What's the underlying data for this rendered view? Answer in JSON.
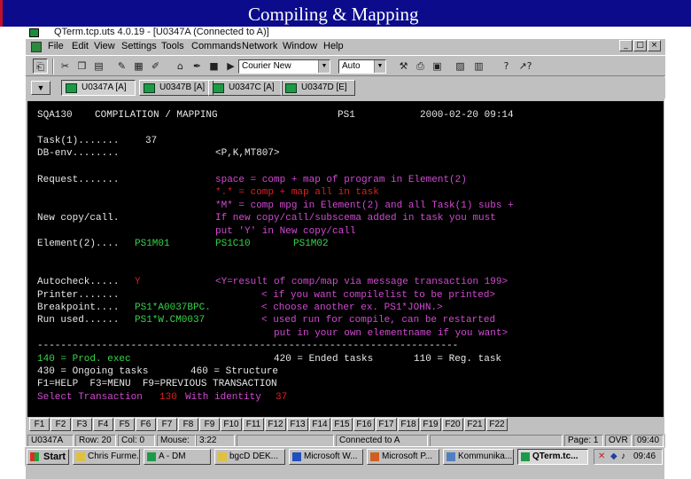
{
  "slide": {
    "title": "Compiling & Mapping"
  },
  "window": {
    "title": "QTerm.tcp.uts 4.0.19 - [U0347A (Connected to A)]",
    "controls": {
      "min": "_",
      "max": "□",
      "close": "×"
    }
  },
  "menu": [
    "File",
    "Edit",
    "View",
    "Settings",
    "Tools",
    "Commands",
    "Network",
    "Window",
    "Help"
  ],
  "toolbar": {
    "font_combo": "Courier New",
    "size_combo": "Auto",
    "help_glyph": "?",
    "whatsthis_glyph": "↗?"
  },
  "sessions": {
    "dropdown": "▼",
    "tabs": [
      {
        "label": "U0347A [A]",
        "active": true
      },
      {
        "label": "U0347B [A]",
        "active": false
      },
      {
        "label": "U0347C [A]",
        "active": false
      },
      {
        "label": "U0347D [E]",
        "active": false
      }
    ]
  },
  "terminal": {
    "header": {
      "screen_id": "SQA130",
      "title": "COMPILATION / MAPPING",
      "system": "PS1",
      "datetime": "2000-02-20 09:14"
    },
    "task_label": "Task(1).......",
    "task_value": "37",
    "dbenv_label": "DB-env........",
    "dbenv_value": "<P,K,MT807>",
    "request_label": "Request.......",
    "request_help": [
      "space = comp + map of program in Element(2)",
      "*.* = comp + map all in task",
      "*M* = comp mpg in Element(2) and all Task(1) subs +",
      "If new copy/call/subscema added in task you must",
      "put 'Y' in New copy/call"
    ],
    "newcopy_label": "New copy/call.",
    "element_label": "Element(2)....",
    "element_values": [
      "PS1M01",
      "PS1C10",
      "PS1M02"
    ],
    "autocheck_label": "Autocheck.....",
    "autocheck_value": "Y",
    "autocheck_help": "<Y=result of comp/map via message transaction 199>",
    "printer_label": "Printer.......",
    "printer_help": "< if you want compilelist to be printed>",
    "breakpoint_label": "Breakpoint....",
    "breakpoint_value": "PS1*A0037BPC.",
    "breakpoint_help": "< choose another ex. PS1*JOHN.>",
    "runused_label": "Run used......",
    "runused_value": "PS1*W.CM0037",
    "runused_help": "< used run for compile, can be restarted",
    "runused_help2": "put in your own elementname if you want>",
    "divider": "------------------------------------------------------------------------",
    "legend_prod": "140 = Prod. exec",
    "legend_ended": "420 = Ended tasks",
    "legend_reg": "110 = Reg. task",
    "legend_ongoing": "430 = Ongoing tasks",
    "legend_structure": "460 = Structure",
    "function_keys": "F1=HELP  F3=MENU  F9=PREVIOUS TRANSACTION",
    "select_prefix": "Select Transaction",
    "select_transaction": "130",
    "select_mid": "With identity",
    "select_identity": "37"
  },
  "fkeys": [
    "F1",
    "F2",
    "F3",
    "F4",
    "F5",
    "F6",
    "F7",
    "F8",
    "F9",
    "F10",
    "F11",
    "F12",
    "F13",
    "F14",
    "F15",
    "F16",
    "F17",
    "F18",
    "F19",
    "F20",
    "F21",
    "F22"
  ],
  "status": {
    "session": "U0347A",
    "row": "Row: 20",
    "col": "Col: 0",
    "mouse": "Mouse:",
    "mouse_pos": "3:22",
    "connection": "Connected to A",
    "page": "Page: 1",
    "mode": "OVR",
    "time": "09:40"
  },
  "taskbar": {
    "start": "Start",
    "items": [
      {
        "label": "Chris Furme...",
        "active": false
      },
      {
        "label": "A - DM",
        "active": false
      },
      {
        "label": "bgcD DEK...",
        "active": false
      },
      {
        "label": "Microsoft W...",
        "active": false
      },
      {
        "label": "Microsoft P...",
        "active": false
      },
      {
        "label": "Kommunika...",
        "active": false
      },
      {
        "label": "QTerm.tc...",
        "active": true
      }
    ],
    "clock": "09:46"
  }
}
